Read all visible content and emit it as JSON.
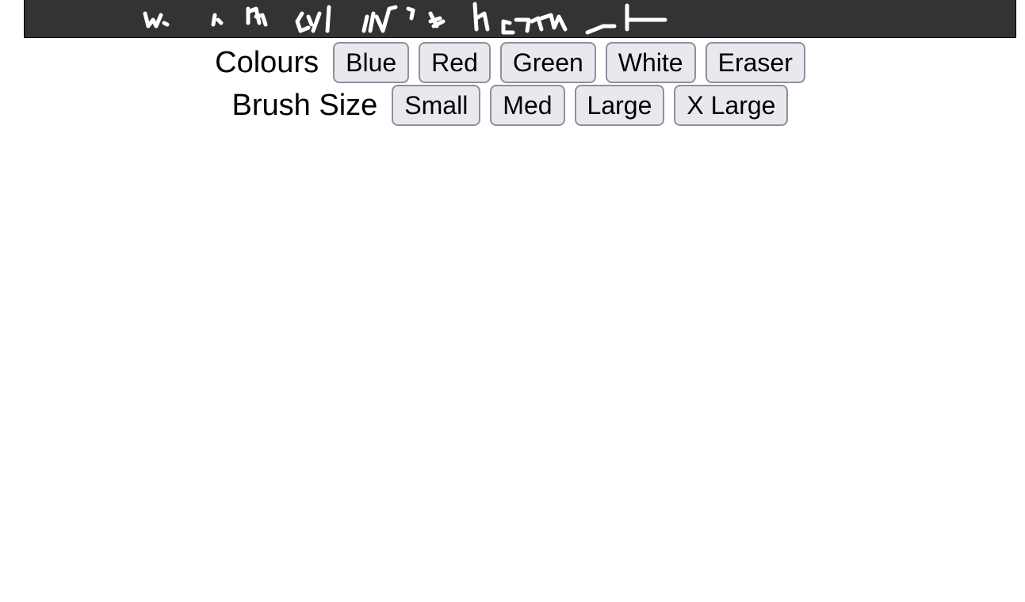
{
  "canvas": {
    "background_color": "#333333",
    "stroke_color": "#ffffff"
  },
  "colours": {
    "label": "Colours",
    "buttons": [
      "Blue",
      "Red",
      "Green",
      "White",
      "Eraser"
    ]
  },
  "brush_size": {
    "label": "Brush Size",
    "buttons": [
      "Small",
      "Med",
      "Large",
      "X Large"
    ]
  }
}
